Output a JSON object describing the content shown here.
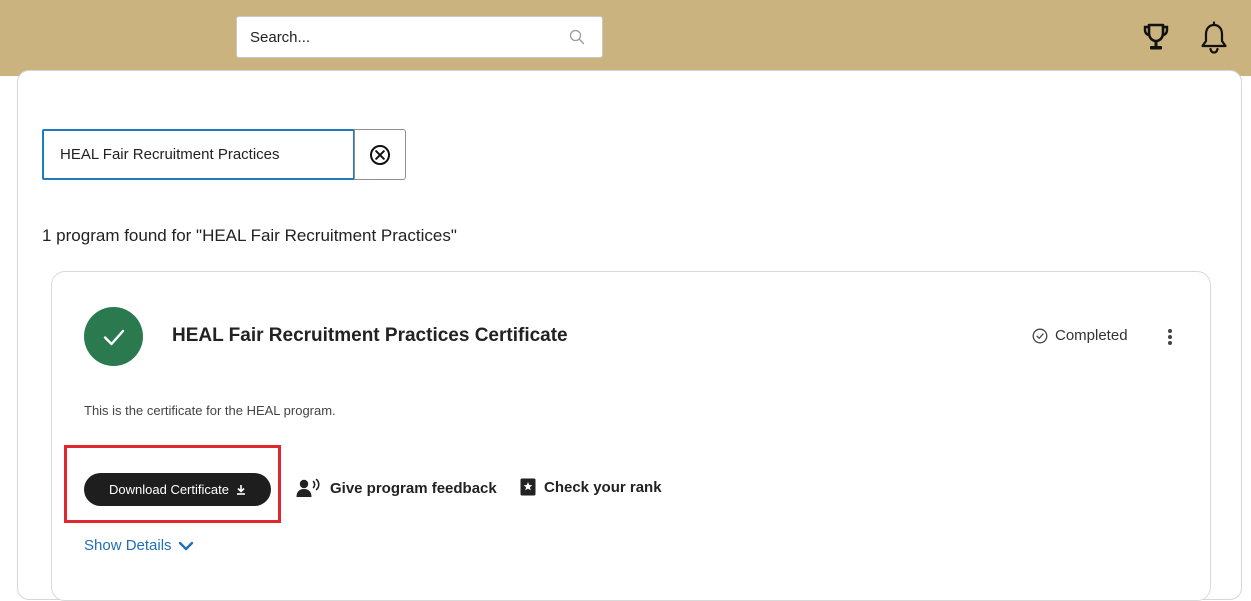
{
  "header": {
    "search_placeholder": "Search...",
    "background_color": "#cbb37f",
    "icons": [
      "search-icon",
      "trophy-icon",
      "bell-icon"
    ]
  },
  "filter": {
    "value": "HEAL Fair Recruitment Practices",
    "clear_icon": "clear-circle-x-icon",
    "focus_color": "#1f7bbd"
  },
  "results": {
    "count_text": "1 program found for \"HEAL Fair Recruitment Practices\""
  },
  "program": {
    "title": "HEAL Fair Recruitment Practices Certificate",
    "status": "Completed",
    "status_icon": "check-circle-outline-icon",
    "check_icon": "check-icon",
    "check_color": "#2b7a4f",
    "description": "This is the certificate for the HEAL program.",
    "download_label": "Download Certificate",
    "download_icon": "download-icon",
    "feedback_label": "Give program feedback",
    "feedback_icon": "speaking-person-icon",
    "rank_label": "Check your rank",
    "rank_icon": "star-bookmark-icon",
    "details_label": "Show Details",
    "details_icon": "chevron-down-icon",
    "highlight_color": "#e2262d"
  }
}
